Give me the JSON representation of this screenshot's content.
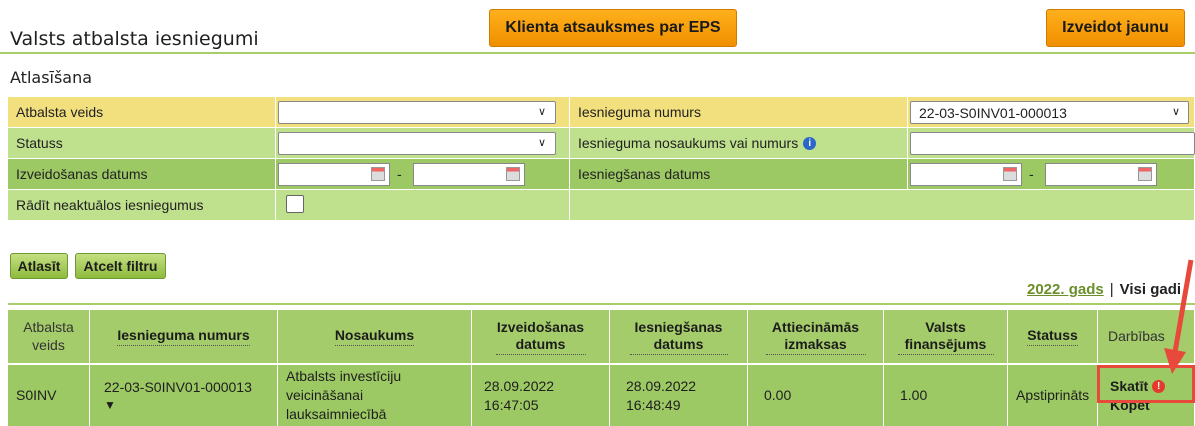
{
  "header": {
    "title": "Valsts atbalsta iesniegumi",
    "feedback_button": "Klienta atsauksmes par EPS",
    "create_button": "Izveidot jaunu"
  },
  "filter": {
    "title": "Atlasīšana",
    "support_type_label": "Atbalsta veids",
    "support_type_value": "",
    "application_number_label": "Iesnieguma numurs",
    "application_number_value": "22-03-S0INV01-000013",
    "status_label": "Statuss",
    "status_value": "",
    "application_name_label": "Iesnieguma nosaukums vai numurs",
    "application_name_value": "",
    "created_date_label": "Izveidošanas datums",
    "submitted_date_label": "Iesniegšanas datums",
    "date_separator": "-",
    "show_inactive_label": "Rādīt neaktuālos iesniegumus",
    "show_inactive_checked": false
  },
  "actions": {
    "apply": "Atlasīt",
    "reset": "Atcelt filtru"
  },
  "years": {
    "current": "2022. gads",
    "separator": "|",
    "all": "Visi gadi"
  },
  "table": {
    "columns": [
      "Atbalsta veids",
      "Iesnieguma numurs",
      "Nosaukums",
      "Izveidošanas datums",
      "Iesniegšanas datums",
      "Attiecināmās izmaksas",
      "Valsts finansējums",
      "Statuss",
      "Darbības"
    ],
    "rows": [
      {
        "support_type": "S0INV",
        "number": "22-03-S0INV01-000013",
        "expand_icon": "▼",
        "name": "Atbalsts investīciju veicināšanai lauksaimniecībā",
        "created": "28.09.2022 16:47:05",
        "submitted": "28.09.2022 16:48:49",
        "eligible_costs": "0.00",
        "state_funding": "1.00",
        "status": "Apstiprināts",
        "action_view": "Skatīt",
        "action_copy": "Kopēt"
      }
    ]
  },
  "colors": {
    "accent_green": "#a5cc6b",
    "button_orange": "#f5a20b",
    "highlight_red": "#e74a3a"
  }
}
